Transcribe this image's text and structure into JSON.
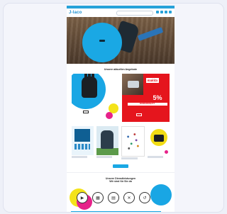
{
  "header": {
    "logo": "J-laco",
    "search_placeholder": "",
    "icons": [
      "account-icon",
      "wishlist-icon",
      "cart-icon",
      "menu-icon"
    ]
  },
  "hero": {
    "title": "",
    "button": ""
  },
  "sections": {
    "offers_title": "Unsere aktuellen Angebote"
  },
  "promos": [
    {
      "title": "",
      "button": ""
    },
    {
      "brand": "makita",
      "percent": "5%",
      "bar_text": "SONDERRABATT",
      "sub": "",
      "button": ""
    }
  ],
  "tiles": [
    {
      "name": "tile-workwear"
    },
    {
      "name": "tile-outdoor"
    },
    {
      "name": "tile-parts"
    },
    {
      "name": "tile-kit"
    }
  ],
  "cta": {
    "label": ""
  },
  "features": {
    "title_line1": "Unsere Dienstleistungen",
    "title_line2": "Wir sind für Sie da"
  },
  "cookie": {
    "accept": ""
  },
  "colors": {
    "brand_blue": "#1aa8e4",
    "accent_yellow": "#f4e31a",
    "accent_magenta": "#e6228a",
    "promo_red": "#e5151d"
  }
}
